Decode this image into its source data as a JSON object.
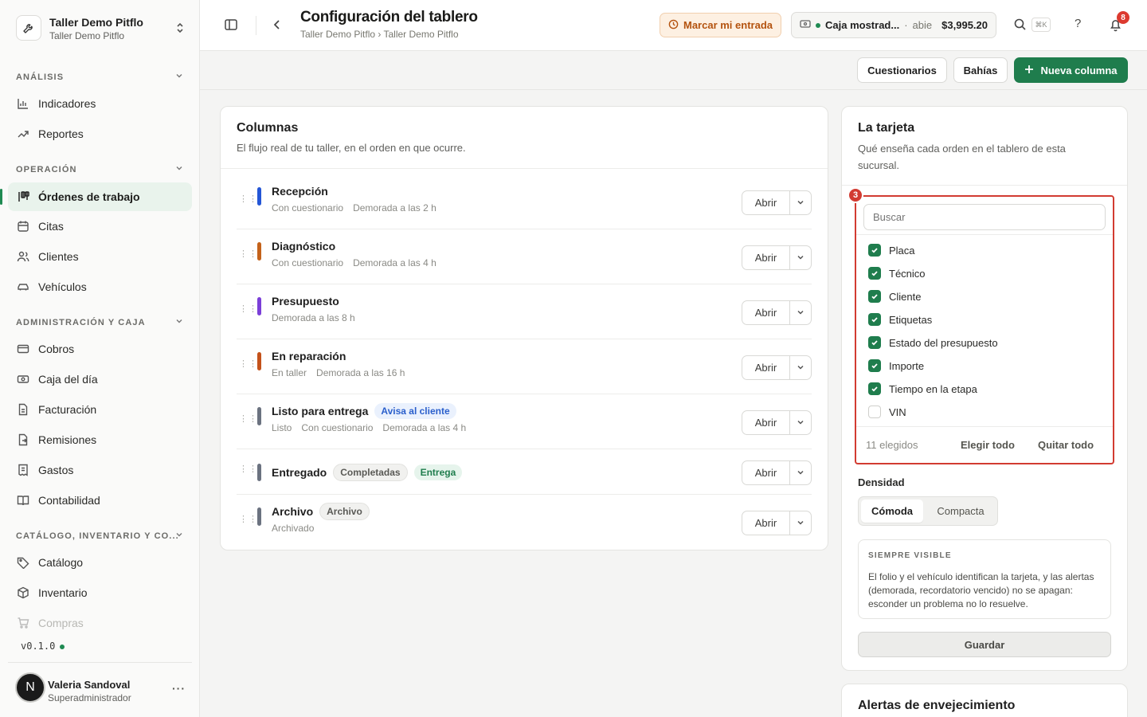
{
  "workspace": {
    "name": "Taller Demo Pitflo",
    "subtitle": "Taller Demo Pitflo"
  },
  "sidebar": {
    "sections": [
      {
        "label": "ANÁLISIS"
      },
      {
        "label": "OPERACIÓN"
      },
      {
        "label": "ADMINISTRACIÓN Y CAJA"
      },
      {
        "label": "CATÁLOGO, INVENTARIO Y CO..."
      }
    ],
    "items": [
      {
        "label": "Indicadores",
        "icon": "bar-chart-icon"
      },
      {
        "label": "Reportes",
        "icon": "trend-icon"
      },
      {
        "label": "Órdenes de trabajo",
        "icon": "kanban-icon",
        "active": true
      },
      {
        "label": "Citas",
        "icon": "calendar-icon"
      },
      {
        "label": "Clientes",
        "icon": "users-icon"
      },
      {
        "label": "Vehículos",
        "icon": "car-icon"
      },
      {
        "label": "Cobros",
        "icon": "card-icon"
      },
      {
        "label": "Caja del día",
        "icon": "cash-icon"
      },
      {
        "label": "Facturación",
        "icon": "invoice-icon"
      },
      {
        "label": "Remisiones",
        "icon": "delivery-note-icon"
      },
      {
        "label": "Gastos",
        "icon": "receipt-icon"
      },
      {
        "label": "Contabilidad",
        "icon": "book-icon"
      },
      {
        "label": "Catálogo",
        "icon": "tag-icon"
      },
      {
        "label": "Inventario",
        "icon": "box-icon"
      },
      {
        "label": "Compras",
        "icon": "cart-icon"
      }
    ],
    "version": "v0.1.0",
    "user": {
      "initial": "N",
      "name": "Valeria Sandoval",
      "role": "Superadministrador"
    }
  },
  "header": {
    "title": "Configuración del tablero",
    "breadcrumb": "Taller Demo Pitflo › Taller Demo Pitflo",
    "clock_in": "Marcar mi entrada",
    "cash_register": {
      "name": "Caja mostrad...",
      "status": "abie",
      "amount": "$3,995.20"
    },
    "shortcut": "⌘K",
    "notifications": "8"
  },
  "actions": {
    "questionnaires": "Cuestionarios",
    "bays": "Bahías",
    "new_column": "Nueva columna"
  },
  "columns_card": {
    "title": "Columnas",
    "subtitle": "El flujo real de tu taller, en el orden en que ocurre.",
    "open_label": "Abrir",
    "rows": [
      {
        "name": "Recepción",
        "color": "#2456d6",
        "meta": [
          "Con cuestionario",
          "Demorada a las 2 h"
        ],
        "tags": []
      },
      {
        "name": "Diagnóstico",
        "color": "#c4621a",
        "meta": [
          "Con cuestionario",
          "Demorada a las 4 h"
        ],
        "tags": []
      },
      {
        "name": "Presupuesto",
        "color": "#7b3fd8",
        "meta": [
          "Demorada a las 8 h"
        ],
        "tags": []
      },
      {
        "name": "En reparación",
        "color": "#c4521a",
        "meta": [
          "En taller",
          "Demorada a las 16 h"
        ],
        "tags": []
      },
      {
        "name": "Listo para entrega",
        "color": "#6b7280",
        "meta": [
          "Listo",
          "Con cuestionario",
          "Demorada a las 4 h"
        ],
        "tags": [
          {
            "label": "Avisa al cliente",
            "style": "blue"
          }
        ]
      },
      {
        "name": "Entregado",
        "color": "#6b7280",
        "meta": [],
        "tags": [
          {
            "label": "Completadas",
            "style": "gray"
          },
          {
            "label": "Entrega",
            "style": "green"
          }
        ]
      },
      {
        "name": "Archivo",
        "color": "#6b7280",
        "meta": [
          "Archivado"
        ],
        "tags": [
          {
            "label": "Archivo",
            "style": "gray"
          }
        ]
      }
    ]
  },
  "card_panel": {
    "title": "La tarjeta",
    "subtitle_line1": "Qué enseña cada orden en el tablero de esta",
    "subtitle_line2": "sucursal.",
    "marker": "3",
    "search_placeholder": "Buscar",
    "fields": [
      {
        "label": "Placa",
        "checked": true
      },
      {
        "label": "Técnico",
        "checked": true
      },
      {
        "label": "Cliente",
        "checked": true
      },
      {
        "label": "Etiquetas",
        "checked": true
      },
      {
        "label": "Estado del presupuesto",
        "checked": true
      },
      {
        "label": "Importe",
        "checked": true
      },
      {
        "label": "Tiempo en la etapa",
        "checked": true
      },
      {
        "label": "VIN",
        "checked": false
      }
    ],
    "selected_count": "11 elegidos",
    "select_all": "Elegir todo",
    "clear_all": "Quitar todo",
    "density_label": "Densidad",
    "density_options": [
      "Cómoda",
      "Compacta"
    ],
    "always_visible_title": "SIEMPRE VISIBLE",
    "always_visible_text": "El folio y el vehículo identifican la tarjeta, y las alertas (demorada, recordatorio vencido) no se apagan: esconder un problema no lo resuelve.",
    "save": "Guardar"
  },
  "aging_card": {
    "title": "Alertas de envejecimiento"
  }
}
